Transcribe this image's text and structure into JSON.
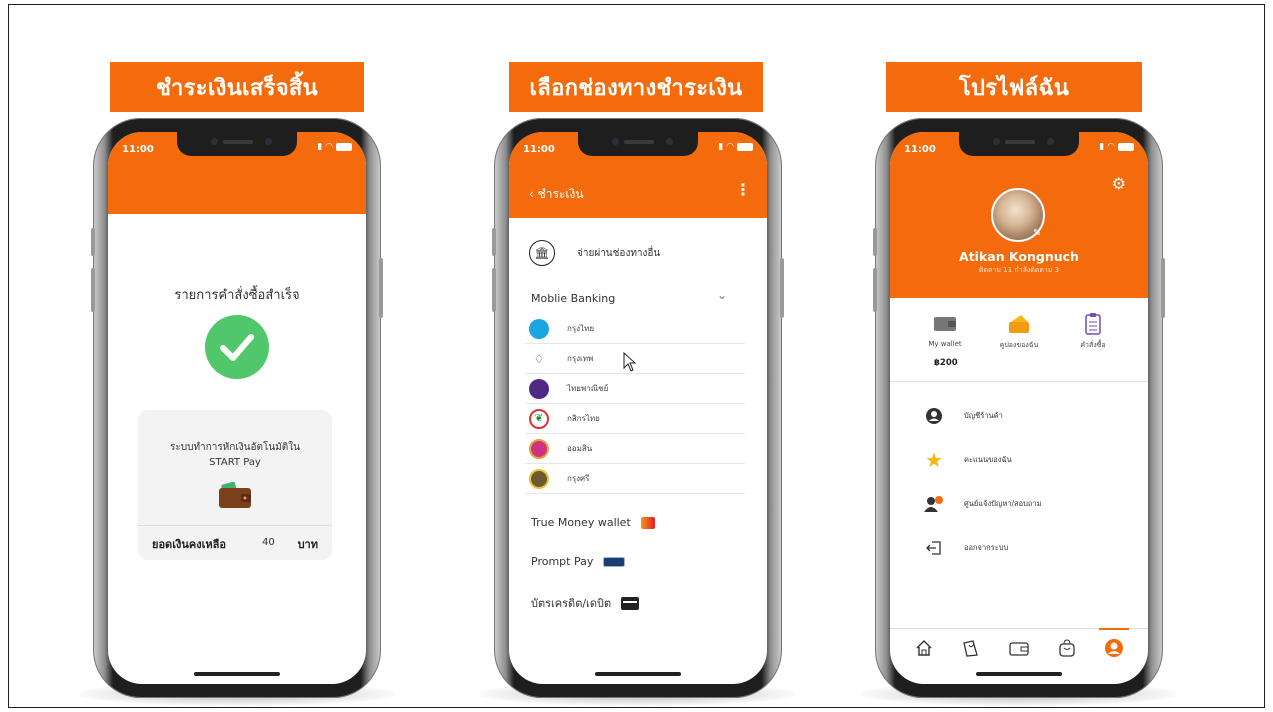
{
  "colors": {
    "brand": "#f36b0c",
    "success": "#4fc76a"
  },
  "banners": {
    "b1": "ชำระเงินเสร็จสิ้น",
    "b2": "เลือกช่องทางชำระเงิน",
    "b3": "โปรไฟล์ฉัน"
  },
  "status": {
    "time": "11:00"
  },
  "success_screen": {
    "title": "รายการคำสั่งซื้อสำเร็จ",
    "card_line1": "ระบบทำการหักเงินอัตโนมัติใน",
    "card_line2": "START Pay",
    "balance_label": "ยอดเงินคงเหลือ",
    "balance_amount": "40",
    "balance_unit": "บาท"
  },
  "payment_screen": {
    "header_title": "ชำระเงิน",
    "other_channel": "จ่ายผ่านช่องทางอื่น",
    "mobile_banking": "Moblie Banking",
    "banks": [
      {
        "name": "กรุงไทย",
        "icon": "ktb-logo",
        "color": "#1ba5e1"
      },
      {
        "name": "กรุงเทพ",
        "icon": "bbl-logo",
        "color": "#1e4598"
      },
      {
        "name": "ไทยพาณิชย์",
        "icon": "scb-logo",
        "color": "#4e2a84"
      },
      {
        "name": "กสิกรไทย",
        "icon": "kbank-logo",
        "color": "#138f2d"
      },
      {
        "name": "ออมสิน",
        "icon": "gsb-logo",
        "color": "#d1327f"
      },
      {
        "name": "กรุงศรี",
        "icon": "krungsri-logo",
        "color": "#6d5a2e"
      }
    ],
    "true_money": "True Money wallet",
    "prompt_pay": "Prompt Pay",
    "card": "บัตรเครดิต/เดบิต"
  },
  "profile_screen": {
    "name": "Atikan Kongnuch",
    "follow_text": "ติดตาม 11 กำลังติดตาม 3",
    "quick": [
      {
        "label": "My wallet",
        "icon": "wallet-icon"
      },
      {
        "label": "คูปองของฉัน",
        "icon": "coupon-icon"
      },
      {
        "label": "คำสั่งซื้อ",
        "icon": "order-list-icon"
      }
    ],
    "wallet_value": "฿200",
    "menu": [
      {
        "label": "บัญชีร้านค้า",
        "icon": "account-icon"
      },
      {
        "label": "คะแนนของฉัน",
        "icon": "star-icon"
      },
      {
        "label": "ศูนย์แจ้งปัญหา/สอบถาม",
        "icon": "support-icon"
      },
      {
        "label": "ออกจากระบบ",
        "icon": "logout-icon"
      }
    ],
    "tabs": [
      "home-icon",
      "shop-icon",
      "wallet-icon",
      "bag-icon",
      "profile-icon"
    ]
  }
}
